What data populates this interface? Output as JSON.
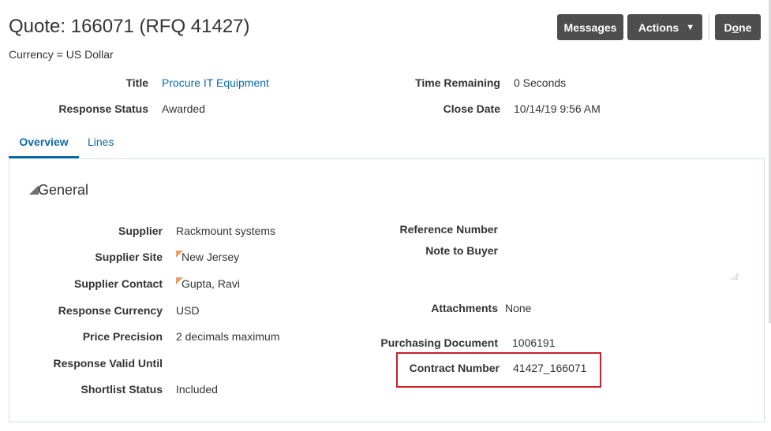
{
  "header": {
    "title": "Quote: 166071 (RFQ 41427)",
    "currency": "Currency = US Dollar"
  },
  "buttons": {
    "messages": "Messages",
    "actions": "Actions",
    "done_prefix": "D",
    "done_underlined": "o",
    "done_suffix": "ne"
  },
  "summary": {
    "title_label": "Title",
    "title_value": "Procure IT Equipment",
    "response_status_label": "Response Status",
    "response_status_value": "Awarded",
    "time_remaining_label": "Time Remaining",
    "time_remaining_value": "0 Seconds",
    "close_date_label": "Close Date",
    "close_date_value": "10/14/19 9:56 AM"
  },
  "tabs": [
    {
      "label": "Overview",
      "selected": true
    },
    {
      "label": "Lines",
      "selected": false
    }
  ],
  "general": {
    "section_title": "General",
    "supplier_label": "Supplier",
    "supplier_value": "Rackmount systems",
    "supplier_site_label": "Supplier Site",
    "supplier_site_value": "New Jersey",
    "supplier_contact_label": "Supplier Contact",
    "supplier_contact_value": "Gupta, Ravi",
    "response_currency_label": "Response Currency",
    "response_currency_value": "USD",
    "price_precision_label": "Price Precision",
    "price_precision_value": "2 decimals maximum",
    "response_valid_until_label": "Response Valid Until",
    "shortlist_status_label": "Shortlist Status",
    "shortlist_status_value": "Included",
    "reference_number_label": "Reference Number",
    "note_to_buyer_label": "Note to Buyer",
    "attachments_label": "Attachments",
    "attachments_value": "None",
    "purchasing_document_label": "Purchasing Document",
    "purchasing_document_value": "1006191",
    "contract_number_label": "Contract Number",
    "contract_number_value": "41427_166071"
  },
  "colors": {
    "link": "#0b6aa9",
    "button_bg": "#4e4e4e",
    "highlight_border": "#c8202a",
    "flag": "#e8a068"
  }
}
